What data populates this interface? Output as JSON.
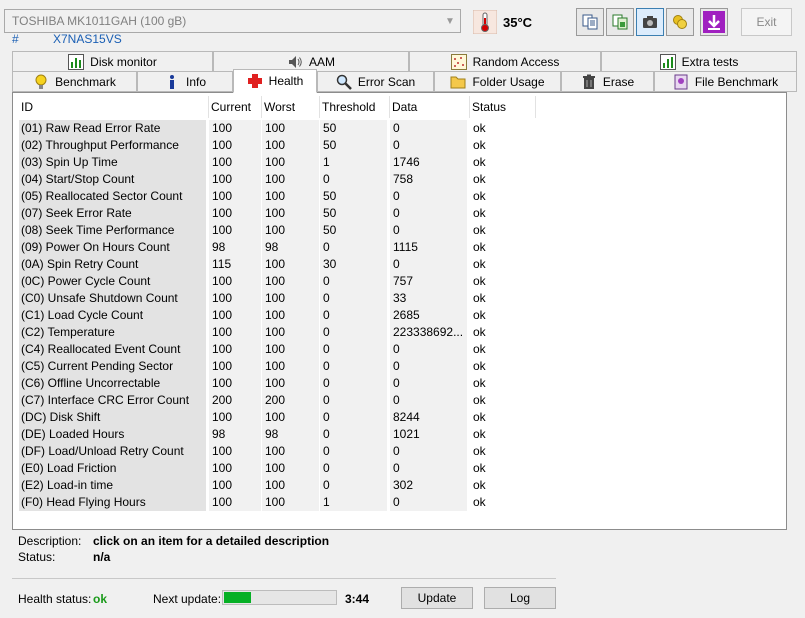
{
  "drive": {
    "name": "TOSHIBA MK1011GAH (100 gB)",
    "hash": "#",
    "serial": "X7NAS15VS"
  },
  "temperature": "35°C",
  "toolbar": {
    "exit_label": "Exit",
    "buttons": [
      "copy-text-icon",
      "copy-image-icon",
      "camera-icon",
      "coins-icon",
      "download-icon"
    ]
  },
  "tabs_top": [
    "Disk monitor",
    "AAM",
    "Random Access",
    "Extra tests"
  ],
  "tabs_bottom": [
    "Benchmark",
    "Info",
    "Health",
    "Error Scan",
    "Folder Usage",
    "Erase",
    "File Benchmark"
  ],
  "selected_tab": "Health",
  "table": {
    "headers": [
      "ID",
      "Current",
      "Worst",
      "Threshold",
      "Data",
      "Status"
    ],
    "rows": [
      [
        "(01) Raw Read Error Rate",
        "100",
        "100",
        "50",
        "0",
        "ok"
      ],
      [
        "(02) Throughput Performance",
        "100",
        "100",
        "50",
        "0",
        "ok"
      ],
      [
        "(03) Spin Up Time",
        "100",
        "100",
        "1",
        "1746",
        "ok"
      ],
      [
        "(04) Start/Stop Count",
        "100",
        "100",
        "0",
        "758",
        "ok"
      ],
      [
        "(05) Reallocated Sector Count",
        "100",
        "100",
        "50",
        "0",
        "ok"
      ],
      [
        "(07) Seek Error Rate",
        "100",
        "100",
        "50",
        "0",
        "ok"
      ],
      [
        "(08) Seek Time Performance",
        "100",
        "100",
        "50",
        "0",
        "ok"
      ],
      [
        "(09) Power On Hours Count",
        "98",
        "98",
        "0",
        "1115",
        "ok"
      ],
      [
        "(0A) Spin Retry Count",
        "115",
        "100",
        "30",
        "0",
        "ok"
      ],
      [
        "(0C) Power Cycle Count",
        "100",
        "100",
        "0",
        "757",
        "ok"
      ],
      [
        "(C0) Unsafe Shutdown Count",
        "100",
        "100",
        "0",
        "33",
        "ok"
      ],
      [
        "(C1) Load Cycle Count",
        "100",
        "100",
        "0",
        "2685",
        "ok"
      ],
      [
        "(C2) Temperature",
        "100",
        "100",
        "0",
        "223338692...",
        "ok"
      ],
      [
        "(C4) Reallocated Event Count",
        "100",
        "100",
        "0",
        "0",
        "ok"
      ],
      [
        "(C5) Current Pending Sector",
        "100",
        "100",
        "0",
        "0",
        "ok"
      ],
      [
        "(C6) Offline Uncorrectable",
        "100",
        "100",
        "0",
        "0",
        "ok"
      ],
      [
        "(C7) Interface CRC Error Count",
        "200",
        "200",
        "0",
        "0",
        "ok"
      ],
      [
        "(DC) Disk Shift",
        "100",
        "100",
        "0",
        "8244",
        "ok"
      ],
      [
        "(DE) Loaded Hours",
        "98",
        "98",
        "0",
        "1021",
        "ok"
      ],
      [
        "(DF) Load/Unload Retry Count",
        "100",
        "100",
        "0",
        "0",
        "ok"
      ],
      [
        "(E0) Load Friction",
        "100",
        "100",
        "0",
        "0",
        "ok"
      ],
      [
        "(E2) Load-in time",
        "100",
        "100",
        "0",
        "302",
        "ok"
      ],
      [
        "(F0) Head Flying Hours",
        "100",
        "100",
        "1",
        "0",
        "ok"
      ]
    ]
  },
  "description": {
    "label": "Description:",
    "value": "click on an item for a detailed description"
  },
  "status": {
    "label": "Status:",
    "value": "n/a"
  },
  "health": {
    "label": "Health status:",
    "value": "ok",
    "color": "#1a9a1a"
  },
  "next_update": {
    "label": "Next update:",
    "time": "3:44",
    "progress_fraction": 0.24,
    "bar_color": "#06b025"
  },
  "buttons": {
    "update": "Update",
    "log": "Log"
  }
}
